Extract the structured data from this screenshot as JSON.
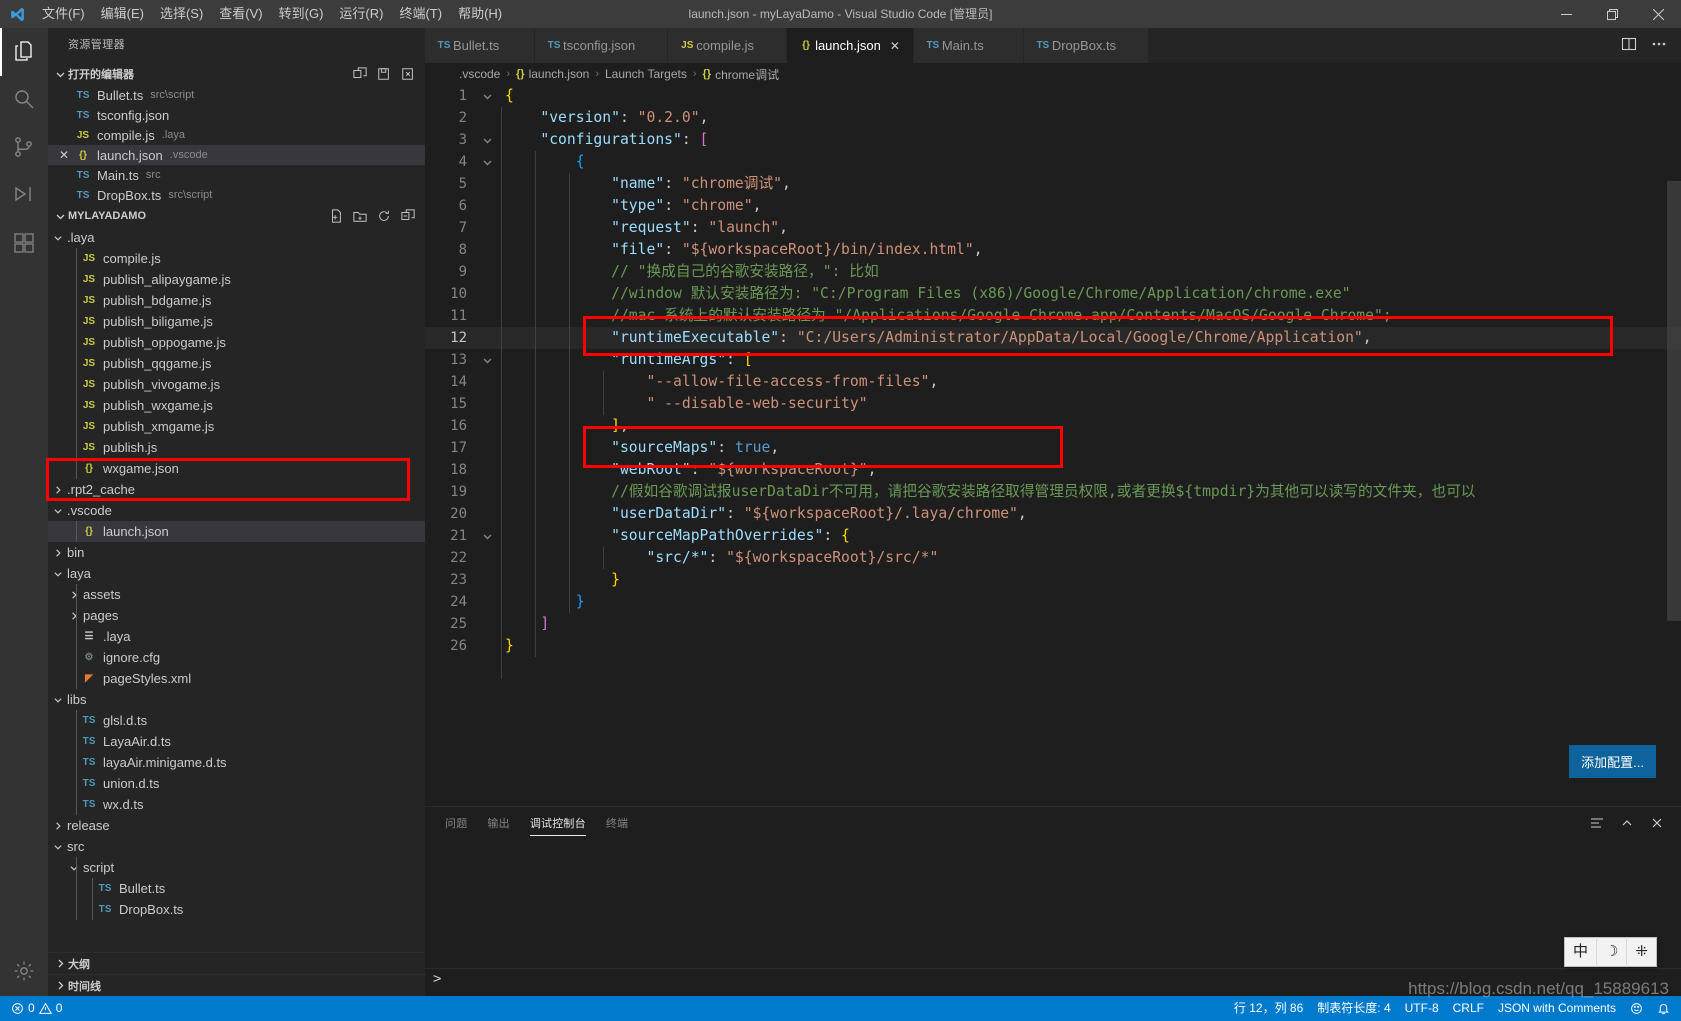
{
  "titlebar": {
    "title": "launch.json - myLayaDamo - Visual Studio Code [管理员]",
    "menus": [
      "文件(F)",
      "编辑(E)",
      "选择(S)",
      "查看(V)",
      "转到(G)",
      "运行(R)",
      "终端(T)",
      "帮助(H)"
    ],
    "window_controls": [
      "minimize-button",
      "restore-button",
      "close-button"
    ]
  },
  "activitybar": {
    "items": [
      {
        "name": "explorer",
        "icon": "files-icon",
        "active": true
      },
      {
        "name": "search",
        "icon": "search-icon",
        "active": false
      },
      {
        "name": "source-control",
        "icon": "source-control-icon",
        "active": false
      },
      {
        "name": "run-and-debug",
        "icon": "debug-icon",
        "active": false
      },
      {
        "name": "extensions",
        "icon": "extensions-icon",
        "active": false
      },
      {
        "name": "manage",
        "icon": "gear-icon",
        "active": false
      }
    ]
  },
  "sidebar": {
    "title": "资源管理器",
    "open_editors": {
      "label": "打开的编辑器",
      "actions": [
        "new-untitled-file-icon",
        "save-all-icon",
        "close-all-icon"
      ],
      "items": [
        {
          "icon": "TS",
          "iconclass": "ts",
          "name": "Bullet.ts",
          "path": "src\\script",
          "active": false,
          "dirty": false
        },
        {
          "icon": "TS",
          "iconclass": "tsj",
          "name": "tsconfig.json",
          "path": "",
          "active": false,
          "dirty": false
        },
        {
          "icon": "JS",
          "iconclass": "js",
          "name": "compile.js",
          "path": ".laya",
          "active": false,
          "dirty": false
        },
        {
          "icon": "{}",
          "iconclass": "json",
          "name": "launch.json",
          "path": ".vscode",
          "active": true,
          "dirty": false
        },
        {
          "icon": "TS",
          "iconclass": "ts",
          "name": "Main.ts",
          "path": "src",
          "active": false,
          "dirty": false
        },
        {
          "icon": "TS",
          "iconclass": "ts",
          "name": "DropBox.ts",
          "path": "src\\script",
          "active": false,
          "dirty": false
        }
      ]
    },
    "project": {
      "label": "MYLAYADAMO",
      "actions": [
        "new-file-icon",
        "new-folder-icon",
        "refresh-icon",
        "collapse-all-icon"
      ],
      "tree": [
        {
          "depth": 1,
          "type": "folder",
          "open": true,
          "label": ".laya",
          "icon": "",
          "iconclass": ""
        },
        {
          "depth": 2,
          "type": "file",
          "label": "compile.js",
          "icon": "JS",
          "iconclass": "js"
        },
        {
          "depth": 2,
          "type": "file",
          "label": "publish_alipaygame.js",
          "icon": "JS",
          "iconclass": "js"
        },
        {
          "depth": 2,
          "type": "file",
          "label": "publish_bdgame.js",
          "icon": "JS",
          "iconclass": "js"
        },
        {
          "depth": 2,
          "type": "file",
          "label": "publish_biligame.js",
          "icon": "JS",
          "iconclass": "js"
        },
        {
          "depth": 2,
          "type": "file",
          "label": "publish_oppogame.js",
          "icon": "JS",
          "iconclass": "js"
        },
        {
          "depth": 2,
          "type": "file",
          "label": "publish_qqgame.js",
          "icon": "JS",
          "iconclass": "js"
        },
        {
          "depth": 2,
          "type": "file",
          "label": "publish_vivogame.js",
          "icon": "JS",
          "iconclass": "js"
        },
        {
          "depth": 2,
          "type": "file",
          "label": "publish_wxgame.js",
          "icon": "JS",
          "iconclass": "js"
        },
        {
          "depth": 2,
          "type": "file",
          "label": "publish_xmgame.js",
          "icon": "JS",
          "iconclass": "js"
        },
        {
          "depth": 2,
          "type": "file",
          "label": "publish.js",
          "icon": "JS",
          "iconclass": "js"
        },
        {
          "depth": 2,
          "type": "file",
          "label": "wxgame.json",
          "icon": "{}",
          "iconclass": "json"
        },
        {
          "depth": 1,
          "type": "folder",
          "open": false,
          "label": ".rpt2_cache",
          "icon": "",
          "iconclass": ""
        },
        {
          "depth": 1,
          "type": "folder",
          "open": true,
          "label": ".vscode",
          "icon": "",
          "iconclass": "",
          "highlight": true
        },
        {
          "depth": 2,
          "type": "file",
          "label": "launch.json",
          "icon": "{}",
          "iconclass": "json",
          "selected": true,
          "highlight": true
        },
        {
          "depth": 1,
          "type": "folder",
          "open": false,
          "label": "bin",
          "icon": "",
          "iconclass": ""
        },
        {
          "depth": 1,
          "type": "folder",
          "open": true,
          "label": "laya",
          "icon": "",
          "iconclass": ""
        },
        {
          "depth": 2,
          "type": "folder",
          "open": false,
          "label": "assets",
          "icon": "",
          "iconclass": ""
        },
        {
          "depth": 2,
          "type": "folder",
          "open": false,
          "label": "pages",
          "icon": "",
          "iconclass": ""
        },
        {
          "depth": 2,
          "type": "file",
          "label": ".laya",
          "icon": "☰",
          "iconclass": "laya"
        },
        {
          "depth": 2,
          "type": "file",
          "label": "ignore.cfg",
          "icon": "⚙",
          "iconclass": "cfg"
        },
        {
          "depth": 2,
          "type": "file",
          "label": "pageStyles.xml",
          "icon": "◤",
          "iconclass": "xml"
        },
        {
          "depth": 1,
          "type": "folder",
          "open": true,
          "label": "libs",
          "icon": "",
          "iconclass": ""
        },
        {
          "depth": 2,
          "type": "file",
          "label": "glsl.d.ts",
          "icon": "TS",
          "iconclass": "ts"
        },
        {
          "depth": 2,
          "type": "file",
          "label": "LayaAir.d.ts",
          "icon": "TS",
          "iconclass": "ts"
        },
        {
          "depth": 2,
          "type": "file",
          "label": "layaAir.minigame.d.ts",
          "icon": "TS",
          "iconclass": "ts"
        },
        {
          "depth": 2,
          "type": "file",
          "label": "union.d.ts",
          "icon": "TS",
          "iconclass": "ts"
        },
        {
          "depth": 2,
          "type": "file",
          "label": "wx.d.ts",
          "icon": "TS",
          "iconclass": "ts"
        },
        {
          "depth": 1,
          "type": "folder",
          "open": false,
          "label": "release",
          "icon": "",
          "iconclass": ""
        },
        {
          "depth": 1,
          "type": "folder",
          "open": true,
          "label": "src",
          "icon": "",
          "iconclass": ""
        },
        {
          "depth": 2,
          "type": "folder",
          "open": true,
          "label": "script",
          "icon": "",
          "iconclass": ""
        },
        {
          "depth": 3,
          "type": "file",
          "label": "Bullet.ts",
          "icon": "TS",
          "iconclass": "ts"
        },
        {
          "depth": 3,
          "type": "file",
          "label": "DropBox.ts",
          "icon": "TS",
          "iconclass": "ts"
        }
      ]
    },
    "bottom_sections": [
      {
        "label": "大纲"
      },
      {
        "label": "时间线"
      }
    ]
  },
  "editor": {
    "tabs": [
      {
        "icon": "TS",
        "iconclass": "ts",
        "label": "Bullet.ts",
        "active": false,
        "closable": false
      },
      {
        "icon": "TS",
        "iconclass": "tsj",
        "label": "tsconfig.json",
        "active": false,
        "closable": false
      },
      {
        "icon": "JS",
        "iconclass": "js",
        "label": "compile.js",
        "active": false,
        "closable": false
      },
      {
        "icon": "{}",
        "iconclass": "json",
        "label": "launch.json",
        "active": true,
        "closable": true
      },
      {
        "icon": "TS",
        "iconclass": "ts",
        "label": "Main.ts",
        "active": false,
        "closable": false
      },
      {
        "icon": "TS",
        "iconclass": "ts",
        "label": "DropBox.ts",
        "active": false,
        "closable": false
      }
    ],
    "tab_actions": [
      "split-editor-icon",
      "more-actions-icon"
    ],
    "breadcrumb": [
      {
        "icon": "",
        "iconclass": "",
        "label": ".vscode"
      },
      {
        "icon": "{}",
        "iconclass": "json",
        "label": "launch.json"
      },
      {
        "icon": "",
        "iconclass": "",
        "label": "Launch Targets"
      },
      {
        "icon": "{}",
        "iconclass": "json",
        "label": "chrome调试"
      }
    ],
    "add_config_button": "添加配置...",
    "lines": [
      {
        "n": 1,
        "fold": "open",
        "indent": 0,
        "tokens": [
          {
            "t": "{",
            "c": "k-brk1"
          }
        ]
      },
      {
        "n": 2,
        "fold": "",
        "indent": 1,
        "tokens": [
          {
            "t": "\"version\"",
            "c": "k-prop"
          },
          {
            "t": ": ",
            "c": "k-punc"
          },
          {
            "t": "\"0.2.0\"",
            "c": "k-str"
          },
          {
            "t": ",",
            "c": "k-punc"
          }
        ]
      },
      {
        "n": 3,
        "fold": "open",
        "indent": 1,
        "tokens": [
          {
            "t": "\"configurations\"",
            "c": "k-prop"
          },
          {
            "t": ": ",
            "c": "k-punc"
          },
          {
            "t": "[",
            "c": "k-brk2"
          }
        ]
      },
      {
        "n": 4,
        "fold": "open",
        "indent": 2,
        "tokens": [
          {
            "t": "{",
            "c": "k-brk3"
          }
        ]
      },
      {
        "n": 5,
        "fold": "",
        "indent": 3,
        "tokens": [
          {
            "t": "\"name\"",
            "c": "k-prop"
          },
          {
            "t": ": ",
            "c": "k-punc"
          },
          {
            "t": "\"chrome调试\"",
            "c": "k-str"
          },
          {
            "t": ",",
            "c": "k-punc"
          }
        ]
      },
      {
        "n": 6,
        "fold": "",
        "indent": 3,
        "tokens": [
          {
            "t": "\"type\"",
            "c": "k-prop"
          },
          {
            "t": ": ",
            "c": "k-punc"
          },
          {
            "t": "\"chrome\"",
            "c": "k-str"
          },
          {
            "t": ",",
            "c": "k-punc"
          }
        ]
      },
      {
        "n": 7,
        "fold": "",
        "indent": 3,
        "tokens": [
          {
            "t": "\"request\"",
            "c": "k-prop"
          },
          {
            "t": ": ",
            "c": "k-punc"
          },
          {
            "t": "\"launch\"",
            "c": "k-str"
          },
          {
            "t": ",",
            "c": "k-punc"
          }
        ]
      },
      {
        "n": 8,
        "fold": "",
        "indent": 3,
        "tokens": [
          {
            "t": "\"file\"",
            "c": "k-prop"
          },
          {
            "t": ": ",
            "c": "k-punc"
          },
          {
            "t": "\"${workspaceRoot}/bin/index.html\"",
            "c": "k-str"
          },
          {
            "t": ",",
            "c": "k-punc"
          }
        ]
      },
      {
        "n": 9,
        "fold": "",
        "indent": 3,
        "tokens": [
          {
            "t": "// \"换成自己的谷歌安装路径，\": 比如",
            "c": "k-com"
          }
        ]
      },
      {
        "n": 10,
        "fold": "",
        "indent": 3,
        "tokens": [
          {
            "t": "//window 默认安装路径为: \"C:/Program Files (x86)/Google/Chrome/Application/chrome.exe\"",
            "c": "k-com"
          }
        ]
      },
      {
        "n": 11,
        "fold": "",
        "indent": 3,
        "tokens": [
          {
            "t": "//mac 系统上的默认安装路径为 \"/Applications/Google Chrome.app/Contents/MacOS/Google Chrome\";",
            "c": "k-com"
          }
        ]
      },
      {
        "n": 12,
        "fold": "",
        "indent": 3,
        "current": true,
        "tokens": [
          {
            "t": "\"runtimeExecutable\"",
            "c": "k-prop"
          },
          {
            "t": ": ",
            "c": "k-punc"
          },
          {
            "t": "\"C:/Users/Administrator/AppData/Local/Google/Chrome/Application\"",
            "c": "k-str"
          },
          {
            "t": ",",
            "c": "k-punc"
          }
        ]
      },
      {
        "n": 13,
        "fold": "open",
        "indent": 3,
        "tokens": [
          {
            "t": "\"runtimeArgs\"",
            "c": "k-prop"
          },
          {
            "t": ": ",
            "c": "k-punc"
          },
          {
            "t": "[",
            "c": "k-brk1"
          }
        ]
      },
      {
        "n": 14,
        "fold": "",
        "indent": 4,
        "tokens": [
          {
            "t": "\"--allow-file-access-from-files\"",
            "c": "k-str"
          },
          {
            "t": ",",
            "c": "k-punc"
          }
        ]
      },
      {
        "n": 15,
        "fold": "",
        "indent": 4,
        "tokens": [
          {
            "t": "\" --disable-web-security\"",
            "c": "k-str"
          }
        ]
      },
      {
        "n": 16,
        "fold": "",
        "indent": 3,
        "tokens": [
          {
            "t": "]",
            "c": "k-brk1"
          },
          {
            "t": ",",
            "c": "k-punc"
          }
        ]
      },
      {
        "n": 17,
        "fold": "",
        "indent": 3,
        "tokens": [
          {
            "t": "\"sourceMaps\"",
            "c": "k-prop"
          },
          {
            "t": ": ",
            "c": "k-punc"
          },
          {
            "t": "true",
            "c": "k-bool"
          },
          {
            "t": ",",
            "c": "k-punc"
          }
        ]
      },
      {
        "n": 18,
        "fold": "",
        "indent": 3,
        "tokens": [
          {
            "t": "\"webRoot\"",
            "c": "k-prop"
          },
          {
            "t": ": ",
            "c": "k-punc"
          },
          {
            "t": "\"${workspaceRoot}\"",
            "c": "k-str"
          },
          {
            "t": ",",
            "c": "k-punc"
          }
        ]
      },
      {
        "n": 19,
        "fold": "",
        "indent": 3,
        "tokens": [
          {
            "t": "//假如谷歌调试报userDataDir不可用，请把谷歌安装路径取得管理员权限,或者更换${tmpdir}为其他可以读写的文件夹，也可以",
            "c": "k-com"
          }
        ]
      },
      {
        "n": 20,
        "fold": "",
        "indent": 3,
        "tokens": [
          {
            "t": "\"userDataDir\"",
            "c": "k-prop"
          },
          {
            "t": ": ",
            "c": "k-punc"
          },
          {
            "t": "\"${workspaceRoot}/.laya/chrome\"",
            "c": "k-str"
          },
          {
            "t": ",",
            "c": "k-punc"
          }
        ]
      },
      {
        "n": 21,
        "fold": "open",
        "indent": 3,
        "tokens": [
          {
            "t": "\"sourceMapPathOverrides\"",
            "c": "k-prop"
          },
          {
            "t": ": ",
            "c": "k-punc"
          },
          {
            "t": "{",
            "c": "k-brk1"
          }
        ]
      },
      {
        "n": 22,
        "fold": "",
        "indent": 4,
        "tokens": [
          {
            "t": "\"src/*\"",
            "c": "k-prop"
          },
          {
            "t": ": ",
            "c": "k-punc"
          },
          {
            "t": "\"${workspaceRoot}/src/*\"",
            "c": "k-str"
          }
        ]
      },
      {
        "n": 23,
        "fold": "",
        "indent": 3,
        "tokens": [
          {
            "t": "}",
            "c": "k-brk1"
          }
        ]
      },
      {
        "n": 24,
        "fold": "",
        "indent": 2,
        "tokens": [
          {
            "t": "}",
            "c": "k-brk3"
          }
        ]
      },
      {
        "n": 25,
        "fold": "",
        "indent": 1,
        "tokens": [
          {
            "t": "]",
            "c": "k-brk2"
          }
        ]
      },
      {
        "n": 26,
        "fold": "",
        "indent": 0,
        "tokens": [
          {
            "t": "}",
            "c": "k-brk1"
          }
        ]
      }
    ]
  },
  "panel": {
    "tabs": [
      {
        "label": "问题",
        "active": false
      },
      {
        "label": "输出",
        "active": false
      },
      {
        "label": "调试控制台",
        "active": true
      },
      {
        "label": "终端",
        "active": false
      }
    ],
    "actions": [
      "clear-console-icon",
      "chevron-up-icon",
      "close-panel-icon"
    ],
    "prompt": ">"
  },
  "statusbar": {
    "left": [
      {
        "name": "problems",
        "icon": "error-icon",
        "text": "0",
        "icon2": "warning-icon",
        "text2": "0"
      }
    ],
    "right": [
      {
        "name": "cursor-position",
        "text": "行 12，列 86"
      },
      {
        "name": "indentation",
        "text": "制表符长度: 4"
      },
      {
        "name": "encoding",
        "text": "UTF-8"
      },
      {
        "name": "eol",
        "text": "CRLF"
      },
      {
        "name": "language-mode",
        "text": "JSON with Comments"
      },
      {
        "name": "feedback",
        "text": "",
        "icon": "smiley-icon"
      },
      {
        "name": "notifications",
        "text": "",
        "icon": "bell-icon"
      }
    ]
  },
  "ime": {
    "items": [
      "中",
      "☽",
      "⁜"
    ]
  },
  "watermark": "https://blog.csdn.net/qq_15889613",
  "colors": {
    "accent": "#007acc",
    "titlebar": "#3c3c3c",
    "sidebar": "#252526",
    "editor": "#1e1e1e",
    "activitybar": "#333333",
    "highlight_box": "#ff0000",
    "button": "#0e639c"
  }
}
